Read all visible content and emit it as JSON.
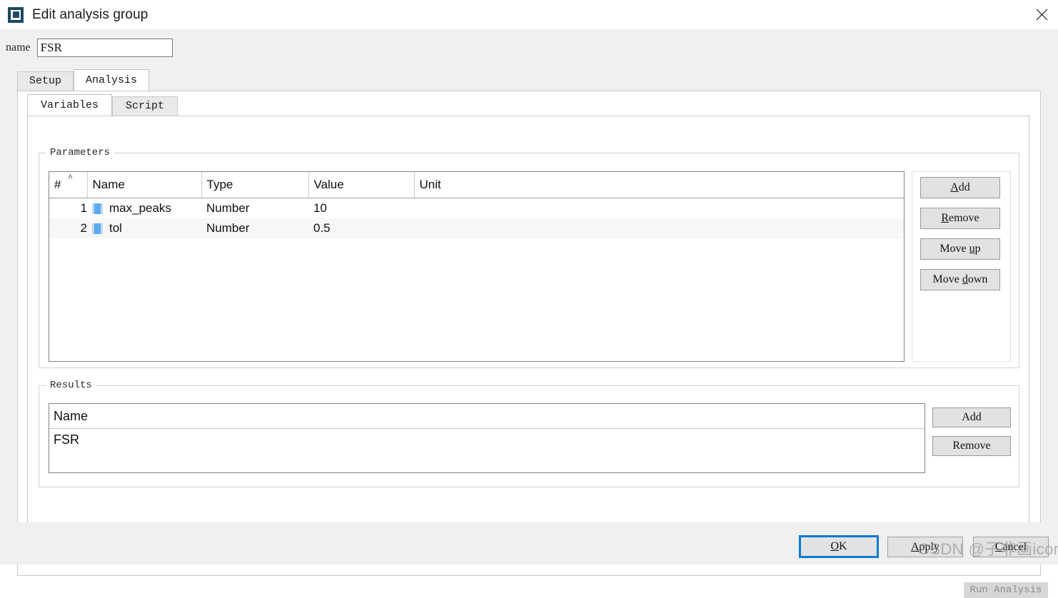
{
  "window": {
    "title": "Edit analysis group",
    "icon": "app-icon",
    "close_label": "✕"
  },
  "name_field": {
    "label": "name",
    "value": "FSR",
    "placeholder": ""
  },
  "outer_tabs": [
    {
      "label": "Setup",
      "active": false
    },
    {
      "label": "Analysis",
      "active": true
    }
  ],
  "inner_tabs": [
    {
      "label": "Variables",
      "active": true
    },
    {
      "label": "Script",
      "active": false
    }
  ],
  "parameters": {
    "legend": "Parameters",
    "sort_indicator": "˄",
    "columns": [
      "#",
      "Name",
      "Type",
      "Value",
      "Unit"
    ],
    "rows": [
      {
        "num": "1",
        "name": "max_peaks",
        "type": "Number",
        "value": "10",
        "unit": ""
      },
      {
        "num": "2",
        "name": "tol",
        "type": "Number",
        "value": "0.5",
        "unit": ""
      }
    ],
    "buttons": {
      "add": "Add",
      "add_mnemonic": "A",
      "remove": "Remove",
      "remove_mnemonic": "R",
      "move_up": "Move up",
      "move_up_mnemonic": "u",
      "move_down": "Move down",
      "move_down_mnemonic": "d"
    }
  },
  "results": {
    "legend": "Results",
    "columns": [
      "Name"
    ],
    "rows": [
      {
        "name": "FSR"
      }
    ],
    "buttons": {
      "add": "Add",
      "remove": "Remove"
    }
  },
  "run_analysis": {
    "label": "Run Analysis",
    "enabled": false
  },
  "footer": {
    "ok": "OK",
    "ok_mnemonic": "O",
    "apply": "Apply",
    "apply_mnemonic": "A",
    "cancel": "Cancel",
    "cancel_mnemonic": "C"
  },
  "watermark": {
    "text": "CSDN @子非画icon"
  },
  "colors": {
    "accent_focus": "#0b79d0",
    "variable_icon": "#5ea8ef",
    "variable_icon_edge": "#bdd9f5",
    "window_chrome": "#f0f0f0",
    "panel": "#ffffff",
    "button_face": "#e2e2e2",
    "disabled_text": "#8d8d8d",
    "title_icon": "#1d4b63"
  }
}
